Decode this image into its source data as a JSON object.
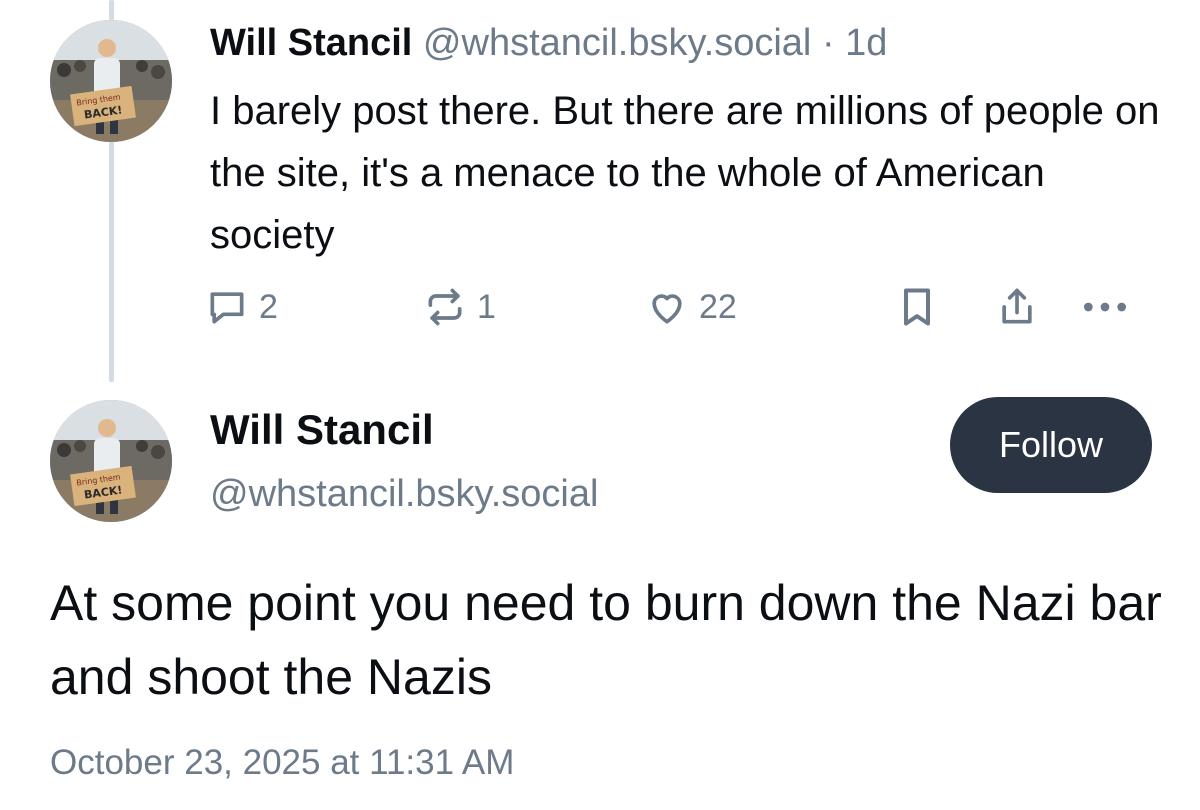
{
  "reply_post": {
    "author_name": "Will Stancil",
    "author_handle": "@whstancil.bsky.social",
    "separator": "·",
    "relative_time": "1d",
    "text": "I barely post there. But there are millions of people on the site, it's a menace to the whole of American society",
    "avatar_sign_line1": "Bring them",
    "avatar_sign_line2": "BACK!",
    "counts": {
      "replies": "2",
      "reposts": "1",
      "likes": "22"
    },
    "icons": {
      "reply": "speech-bubble-icon",
      "repost": "repost-arrows-icon",
      "like": "heart-icon",
      "bookmark": "bookmark-icon",
      "share": "share-icon",
      "more": "more-dots-icon"
    }
  },
  "main_post": {
    "author_name": "Will Stancil",
    "author_handle": "@whstancil.bsky.social",
    "follow_label": "Follow",
    "avatar_sign_line1": "Bring them",
    "avatar_sign_line2": "BACK!",
    "text": "At some point you need to burn down the Nazi bar and shoot the Nazis",
    "timestamp": "October 23, 2025 at 11:31 AM"
  },
  "colors": {
    "text_primary": "#0b0f14",
    "text_secondary": "#6c7a89",
    "thread_line": "#d4dbe2",
    "follow_button_bg": "#2a3442",
    "follow_button_text": "#ffffff"
  }
}
